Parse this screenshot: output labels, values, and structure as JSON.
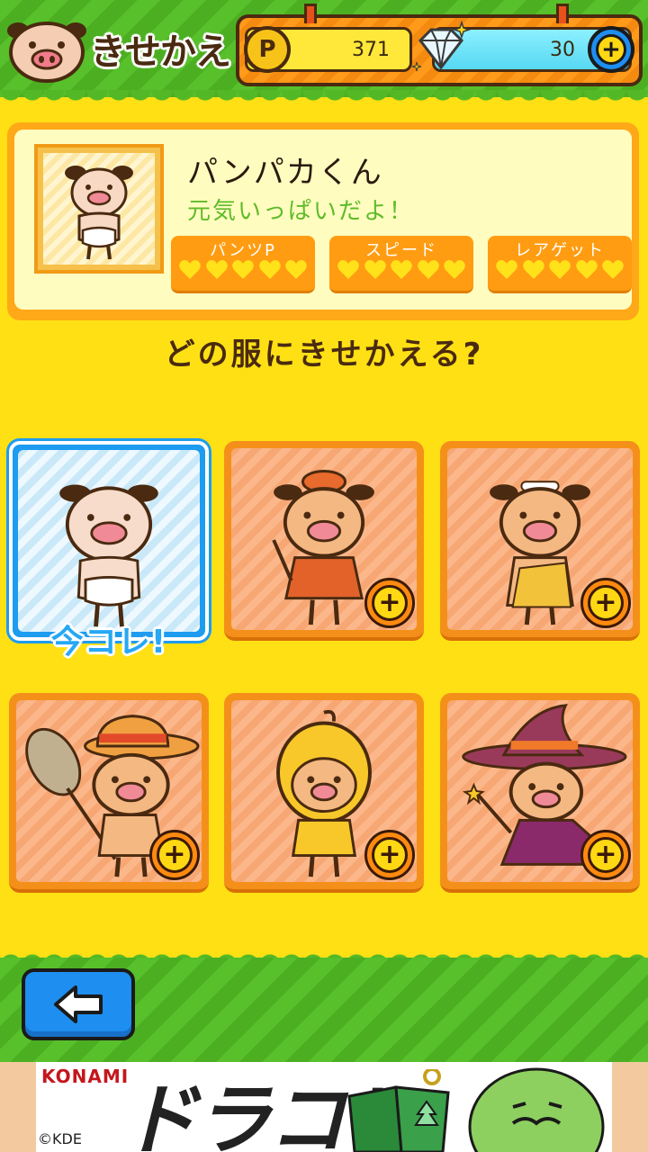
{
  "header": {
    "title": "きせかえ",
    "coins": "371",
    "coin_symbol": "P",
    "gems": "30",
    "add_symbol": "+"
  },
  "character": {
    "name": "パンパカくん",
    "description": "元気いっぱいだよ！",
    "stats": [
      {
        "label": "パンツP",
        "hearts": 5
      },
      {
        "label": "スピード",
        "hearts": 5
      },
      {
        "label": "レアゲット",
        "hearts": 5
      }
    ]
  },
  "prompt": "どの服にきせかえる?",
  "outfits": [
    {
      "name": "default",
      "current": true,
      "badge": "今コレ!"
    },
    {
      "name": "painter",
      "current": false
    },
    {
      "name": "caveman",
      "current": false
    },
    {
      "name": "bug-catcher",
      "current": false
    },
    {
      "name": "yellow-hood",
      "current": false
    },
    {
      "name": "witch",
      "current": false
    }
  ],
  "ad": {
    "brand": "KONAMI",
    "title": "ドラコレ",
    "copyright": "©KDE"
  },
  "colors": {
    "background": "#ffe014",
    "green": "#4caf22",
    "orange": "#ff9c12",
    "blue": "#1e8ef0"
  }
}
